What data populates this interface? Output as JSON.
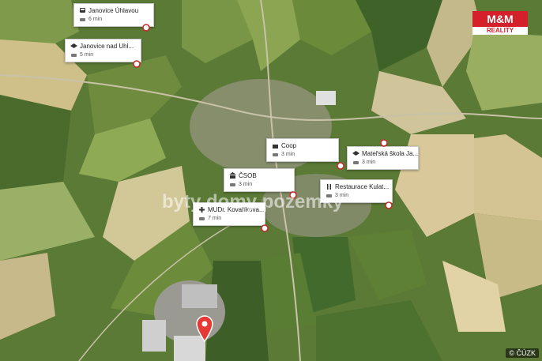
{
  "pois": [
    {
      "name": "Janovice Úhlavou",
      "time": "6 min",
      "icon": "bus-icon",
      "mode": "car-icon"
    },
    {
      "name": "Janovice nad Uhl...",
      "time": "5 min",
      "icon": "school-icon",
      "mode": "car-icon"
    },
    {
      "name": "Coop",
      "time": "3 min",
      "icon": "shop-icon",
      "mode": "car-icon"
    },
    {
      "name": "Mateřská škola Ja...",
      "time": "3 min",
      "icon": "school-icon",
      "mode": "car-icon"
    },
    {
      "name": "ČSOB",
      "time": "3 min",
      "icon": "bank-icon",
      "mode": "car-icon"
    },
    {
      "name": "Restaurace Kulat...",
      "time": "3 min",
      "icon": "restaurant-icon",
      "mode": "car-icon"
    },
    {
      "name": "MUDr. Kovaříkova...",
      "time": "7 min",
      "icon": "doctor-icon",
      "mode": "car-icon"
    }
  ],
  "logo": {
    "line1": "M&M",
    "line2": "REALITY"
  },
  "watermark": "byty domy pozemky",
  "attribution": "© ČÚZK",
  "colors": {
    "brand": "#d4202a",
    "pin": "#e53935"
  }
}
